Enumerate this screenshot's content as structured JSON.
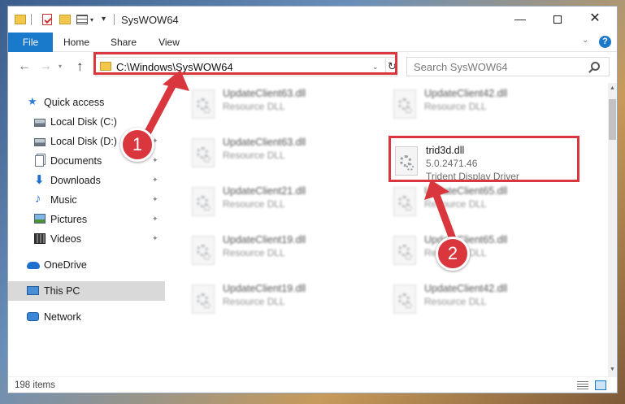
{
  "window": {
    "title": "SysWOW64",
    "minimize_glyph": "—",
    "close_glyph": "✕"
  },
  "ribbon": {
    "tabs": [
      {
        "label": "File",
        "active": true
      },
      {
        "label": "Home"
      },
      {
        "label": "Share"
      },
      {
        "label": "View"
      }
    ],
    "help_glyph": "?"
  },
  "nav": {
    "back_glyph": "←",
    "forward_glyph": "→",
    "recent_glyph": "▾",
    "up_glyph": "↑",
    "address": "C:\\Windows\\SysWOW64",
    "dropdown_glyph": "⌄",
    "refresh_glyph": "↻",
    "search_placeholder": "Search SysWOW64"
  },
  "sidebar": {
    "items": [
      {
        "label": "Quick access",
        "icon": "star-icon",
        "pinned": false
      },
      {
        "label": "Local Disk (C:)",
        "icon": "disk-icon",
        "pinned": true
      },
      {
        "label": "Local Disk (D:)",
        "icon": "disk-icon",
        "pinned": true
      },
      {
        "label": "Documents",
        "icon": "documents-icon",
        "pinned": true
      },
      {
        "label": "Downloads",
        "icon": "download-icon",
        "pinned": true
      },
      {
        "label": "Music",
        "icon": "music-icon",
        "pinned": true
      },
      {
        "label": "Pictures",
        "icon": "pictures-icon",
        "pinned": true
      },
      {
        "label": "Videos",
        "icon": "videos-icon",
        "pinned": true
      },
      {
        "label": "OneDrive",
        "icon": "cloud-icon"
      },
      {
        "label": "This PC",
        "icon": "pc-icon",
        "selected": true
      },
      {
        "label": "Network",
        "icon": "network-icon"
      }
    ],
    "pin_glyph": "📌",
    "star_glyph": "★",
    "download_glyph": "⬇",
    "music_glyph": "♪"
  },
  "files": {
    "left_column": [
      {
        "name": "UpdateClient63.dll",
        "desc": "Resource DLL"
      },
      {
        "name": "UpdateClient63.dll",
        "desc": "Resource DLL"
      },
      {
        "name": "UpdateClient21.dll",
        "desc": "Resource DLL"
      },
      {
        "name": "UpdateClient19.dll",
        "desc": "Resource DLL"
      },
      {
        "name": "UpdateClient19.dll",
        "desc": "Resource DLL"
      }
    ],
    "right_column": [
      {
        "name": "UpdateClient42.dll",
        "desc": "Resource DLL"
      },
      {
        "name": "UpdateClient65.dll",
        "desc": "Resource DLL"
      },
      {
        "name": "UpdateClient65.dll",
        "desc": "Resource DLL"
      },
      {
        "name": "UpdateClient42.dll",
        "desc": "Resource DLL"
      }
    ],
    "target": {
      "name": "trid3d.dll",
      "version": "5.0.2471.46",
      "desc": "Trident Display Driver"
    }
  },
  "status": {
    "item_count": "198 items"
  },
  "annotations": {
    "step1": "1",
    "step2": "2",
    "color": "#d9363e"
  },
  "scroll": {
    "up_glyph": "▲",
    "down_glyph": "▼"
  }
}
